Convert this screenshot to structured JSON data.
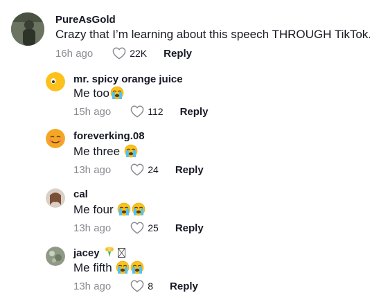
{
  "comments": [
    {
      "user": "PureAsGold",
      "text": "Crazy that I’m learning about this speech THROUGH TikTok.",
      "time": "16h ago",
      "likes": "22K",
      "reply": "Reply"
    },
    {
      "user": "mr. spicy orange juice",
      "text": "Me too",
      "time": "15h ago",
      "likes": "112",
      "reply": "Reply"
    },
    {
      "user": "foreverking.08",
      "text": "Me three",
      "time": "13h ago",
      "likes": "24",
      "reply": "Reply"
    },
    {
      "user": "cal",
      "text": "Me four",
      "time": "13h ago",
      "likes": "25",
      "reply": "Reply"
    },
    {
      "user": "jacey",
      "text": "Me fifth",
      "time": "13h ago",
      "likes": "8",
      "reply": "Reply"
    }
  ],
  "icons": {
    "like": "heart-outline-icon",
    "emoji": "crying-face-emoji"
  }
}
